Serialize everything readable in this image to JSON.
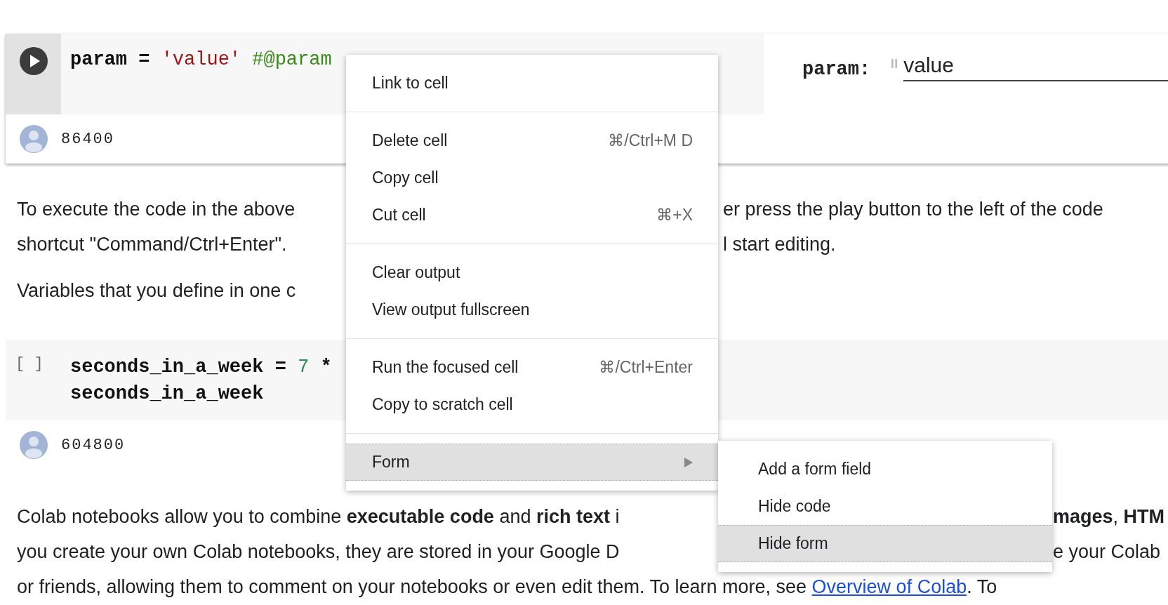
{
  "cells": [
    {
      "kind": "form",
      "code": [
        [
          {
            "text": "param = ",
            "kind": "plain"
          },
          {
            "text": "'value'",
            "kind": "string"
          },
          {
            "text": " #@param",
            "kind": "comment"
          }
        ]
      ],
      "form": {
        "label": "param:",
        "value": "value"
      },
      "output": "86400"
    },
    {
      "kind": "code",
      "prompt": "[ ]",
      "code": [
        [
          {
            "text": "seconds_in_a_week = ",
            "kind": "plain"
          },
          {
            "text": "7",
            "kind": "number"
          },
          {
            "text": " *",
            "kind": "plain"
          }
        ],
        [
          {
            "text": "seconds_in_a_week",
            "kind": "plain"
          }
        ]
      ],
      "output": "604800"
    }
  ],
  "paragraphs": [
    {
      "lines": [
        {
          "left": "To execute the code in the above",
          "right": "er press the play button to the left of the code"
        },
        {
          "left": "shortcut \"Command/Ctrl+Enter\".",
          "right": "l start editing."
        }
      ]
    },
    {
      "lines": [
        {
          "left": "Variables that you define in one c"
        }
      ]
    },
    {
      "lines": [
        {
          "left": "Colab notebooks allow you to combine **executable code** and **rich text** i",
          "right": "**mages**, **HTM**"
        },
        {
          "left": "you create your own Colab notebooks, they are stored in your Google D",
          "right": "e your Colab"
        },
        {
          "left": "or friends, allowing them to comment on your notebooks or even edit them. To learn more, see ",
          "link": "Overview of Colab",
          "after": ". To"
        }
      ]
    }
  ],
  "context_menu": {
    "sections": [
      [
        {
          "label": "Link to cell",
          "kind": "action",
          "selected": false
        }
      ],
      [
        {
          "label": "Delete cell",
          "shortcut": "⌘/Ctrl+M D",
          "kind": "action",
          "selected": false
        },
        {
          "label": "Copy cell",
          "kind": "action",
          "selected": false
        },
        {
          "label": "Cut cell",
          "shortcut": "⌘+X",
          "kind": "action",
          "selected": false
        }
      ],
      [
        {
          "label": "Clear output",
          "kind": "action",
          "selected": false
        },
        {
          "label": "View output fullscreen",
          "kind": "action",
          "selected": false
        }
      ],
      [
        {
          "label": "Run the focused cell",
          "shortcut": "⌘/Ctrl+Enter",
          "kind": "action",
          "selected": false
        },
        {
          "label": "Copy to scratch cell",
          "kind": "action",
          "selected": false
        }
      ],
      [
        {
          "label": "Form",
          "kind": "submenu",
          "selected": true
        }
      ]
    ]
  },
  "submenu": {
    "items": [
      {
        "label": "Add a form field",
        "selected": false
      },
      {
        "label": "Hide code",
        "selected": false
      },
      {
        "label": "Hide form",
        "selected": true
      }
    ]
  }
}
